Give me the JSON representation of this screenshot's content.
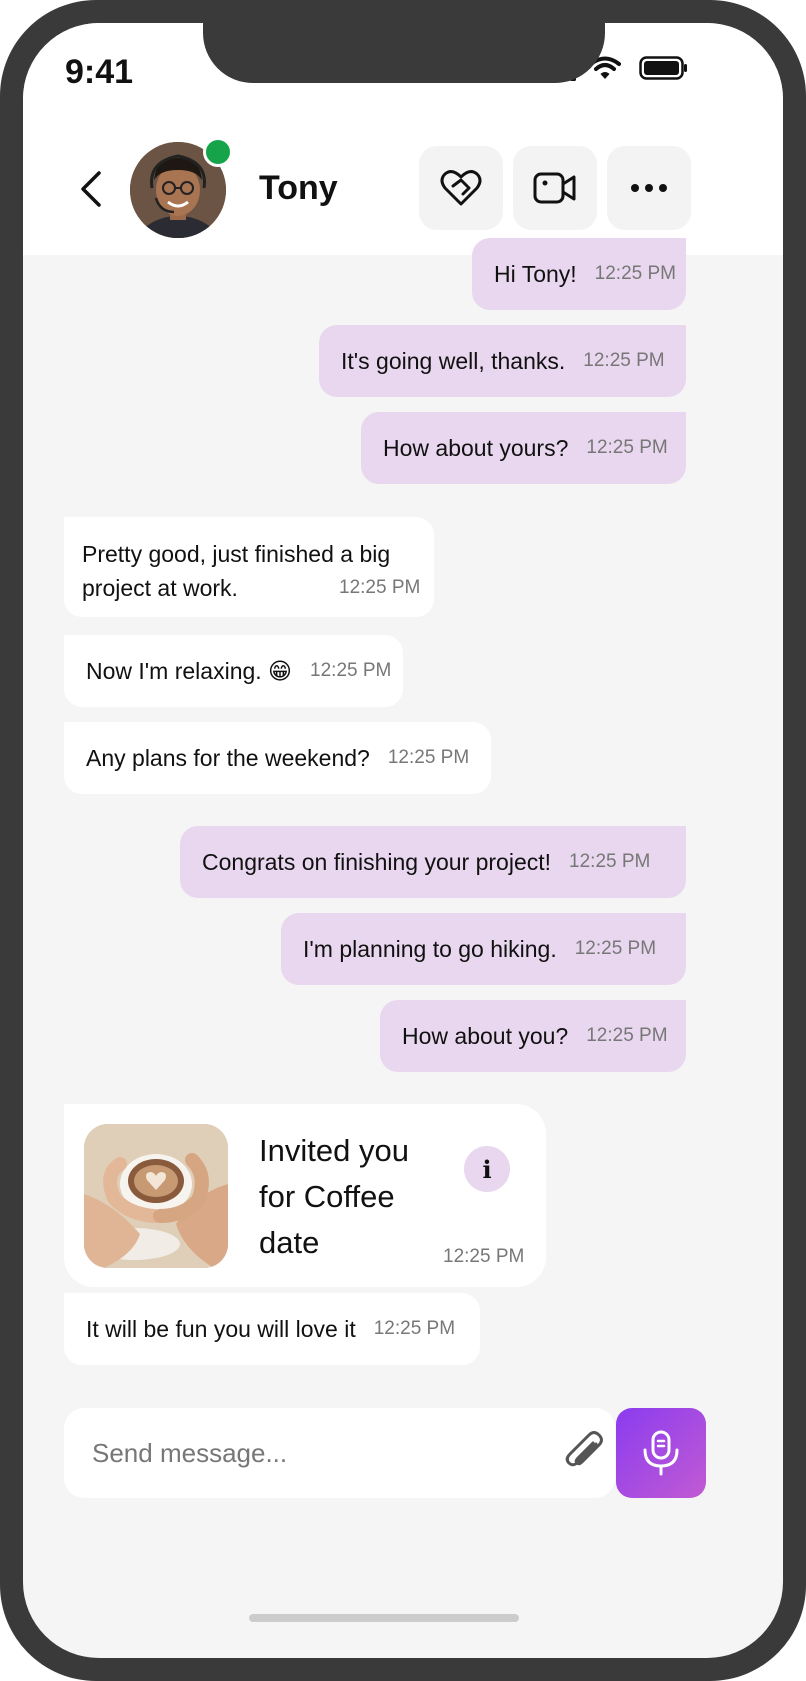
{
  "status_bar": {
    "time": "9:41"
  },
  "header": {
    "contact_name": "Tony",
    "online": true,
    "buttons": [
      "back-icon",
      "heart-handshake-icon",
      "video-call-icon",
      "more-icon"
    ]
  },
  "messages": [
    {
      "dir": "out",
      "text": "Hi Tony!",
      "time": "12:25 PM"
    },
    {
      "dir": "out",
      "text": "It's going well, thanks.",
      "time": "12:25 PM"
    },
    {
      "dir": "out",
      "text": "How about yours?",
      "time": "12:25 PM"
    },
    {
      "dir": "in",
      "text": "Pretty good, just finished a big project at work.",
      "line1": "Pretty good, just finished a big",
      "line2": "project at work.",
      "time": "12:25 PM"
    },
    {
      "dir": "in",
      "text": "Now I'm relaxing. 😁",
      "time": "12:25 PM"
    },
    {
      "dir": "in",
      "text": "Any plans for the weekend?",
      "time": "12:25 PM"
    },
    {
      "dir": "out",
      "text": "Congrats on finishing your project!",
      "time": "12:25 PM"
    },
    {
      "dir": "out",
      "text": "I'm planning to go hiking.",
      "time": "12:25 PM"
    },
    {
      "dir": "out",
      "text": "How about you?",
      "time": "12:25 PM"
    },
    {
      "dir": "in",
      "text": "It will be fun you will love it",
      "time": "12:25 PM"
    }
  ],
  "invite": {
    "line1": "Invited you",
    "line2": "for Coffee",
    "line3": "date",
    "time": "12:25 PM",
    "info_label": "i"
  },
  "composer": {
    "placeholder": "Send message..."
  },
  "colors": {
    "outgoing": "#e8d7ee",
    "incoming": "#ffffff",
    "online": "#16a34a",
    "mic_gradient_start": "#8b3cf0",
    "mic_gradient_end": "#c15bd3"
  }
}
